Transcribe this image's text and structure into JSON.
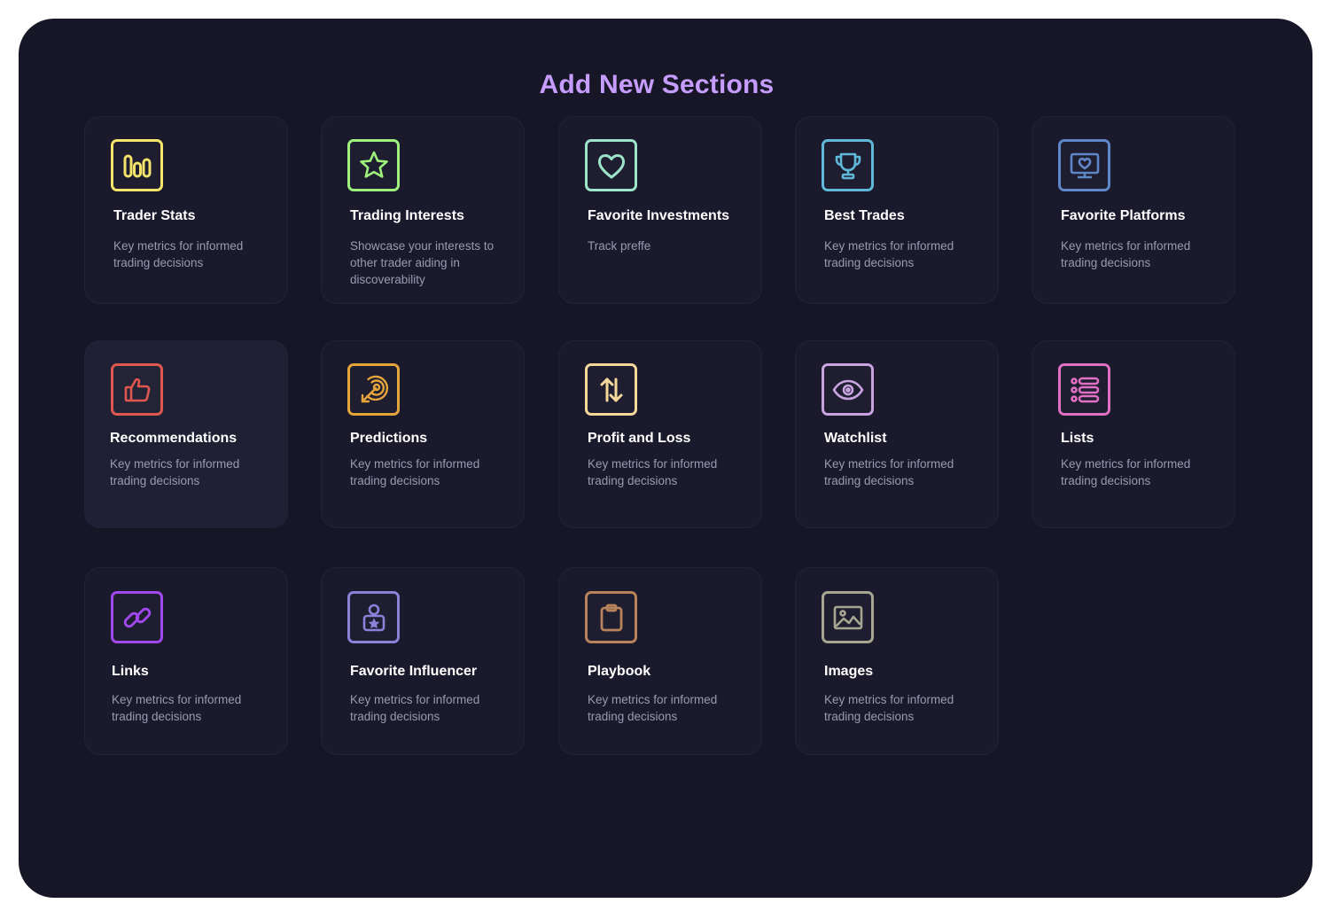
{
  "title": "Add New Sections",
  "cards": [
    {
      "title": "Trader Stats",
      "desc": "Key metrics for informed trading decisions",
      "icon": "bar-stats-icon",
      "color": "#f4e46a"
    },
    {
      "title": "Trading Interests",
      "desc": "Showcase your interests to other trader aiding in discoverability",
      "icon": "star-icon",
      "color": "#9ef27c"
    },
    {
      "title": "Favorite Investments",
      "desc": "Track preffe",
      "icon": "heart-icon",
      "color": "#9de5c9"
    },
    {
      "title": "Best Trades",
      "desc": "Key metrics for informed trading decisions",
      "icon": "trophy-icon",
      "color": "#5fb8d8"
    },
    {
      "title": "Favorite Platforms",
      "desc": "Key metrics for informed trading decisions",
      "icon": "monitor-heart-icon",
      "color": "#5f86c8"
    },
    {
      "title": "Recommendations",
      "desc": "Key metrics for informed trading decisions",
      "icon": "thumbs-up-icon",
      "color": "#e0574f"
    },
    {
      "title": "Predictions",
      "desc": "Key metrics for informed trading decisions",
      "icon": "target-icon",
      "color": "#e5a53a"
    },
    {
      "title": "Profit and Loss",
      "desc": "Key metrics for informed trading decisions",
      "icon": "up-down-arrows-icon",
      "color": "#f6d99a"
    },
    {
      "title": "Watchlist",
      "desc": "Key metrics for informed trading decisions",
      "icon": "eye-icon",
      "color": "#c9a3e0"
    },
    {
      "title": "Lists",
      "desc": "Key metrics for informed trading decisions",
      "icon": "list-icon",
      "color": "#e070c4"
    },
    {
      "title": "Links",
      "desc": "Key metrics for informed trading decisions",
      "icon": "link-icon",
      "color": "#a248f0"
    },
    {
      "title": "Favorite Influencer",
      "desc": "Key metrics for informed trading decisions",
      "icon": "influencer-badge-icon",
      "color": "#8c80d8"
    },
    {
      "title": "Playbook",
      "desc": "Key metrics for informed trading decisions",
      "icon": "clipboard-icon",
      "color": "#b8835a"
    },
    {
      "title": "Images",
      "desc": "Key metrics for informed trading decisions",
      "icon": "image-icon",
      "color": "#a8a690"
    }
  ]
}
